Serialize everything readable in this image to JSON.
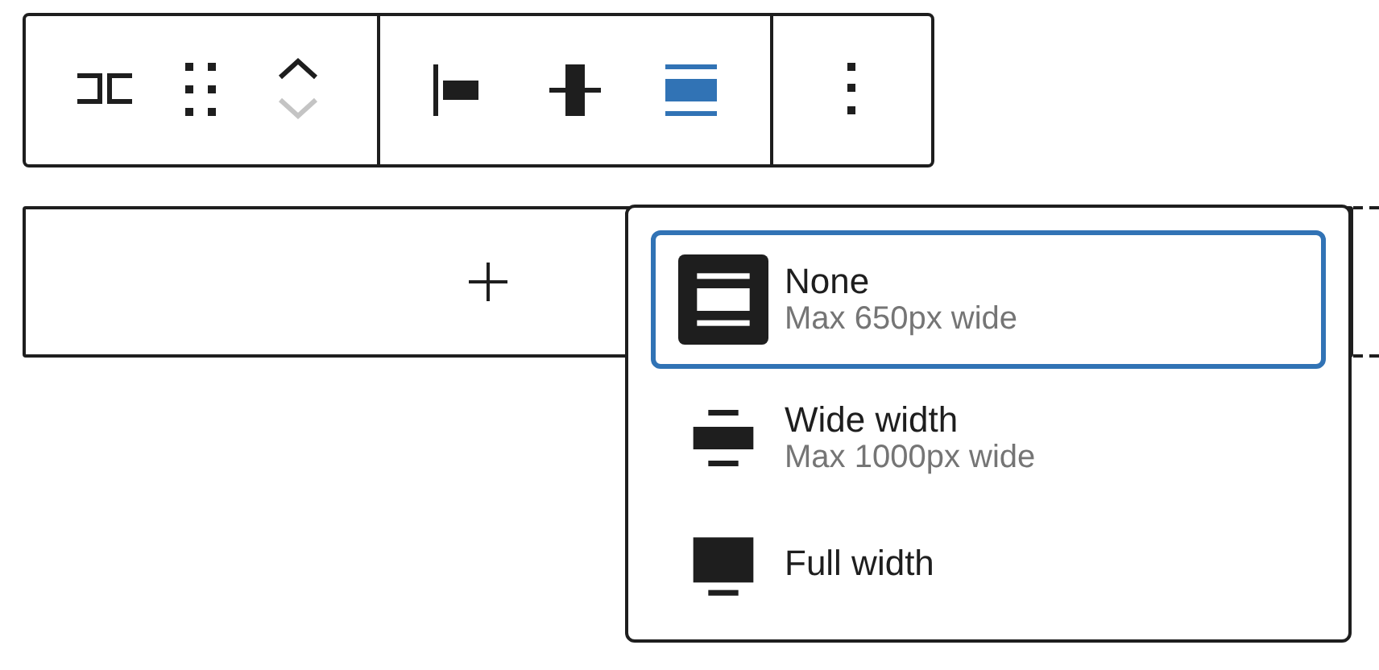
{
  "toolbar": {
    "mover": {
      "up_disabled": false,
      "down_disabled": true
    },
    "alignments": [
      {
        "kind": "left",
        "selected": false
      },
      {
        "kind": "center",
        "selected": false
      },
      {
        "kind": "wide",
        "selected": true
      }
    ]
  },
  "width_menu": {
    "items": [
      {
        "kind": "none",
        "label": "None",
        "description": "Max 650px wide",
        "selected": true
      },
      {
        "kind": "wide",
        "label": "Wide width",
        "description": "Max 1000px wide",
        "selected": false
      },
      {
        "kind": "full",
        "label": "Full width",
        "selected": false
      }
    ]
  }
}
